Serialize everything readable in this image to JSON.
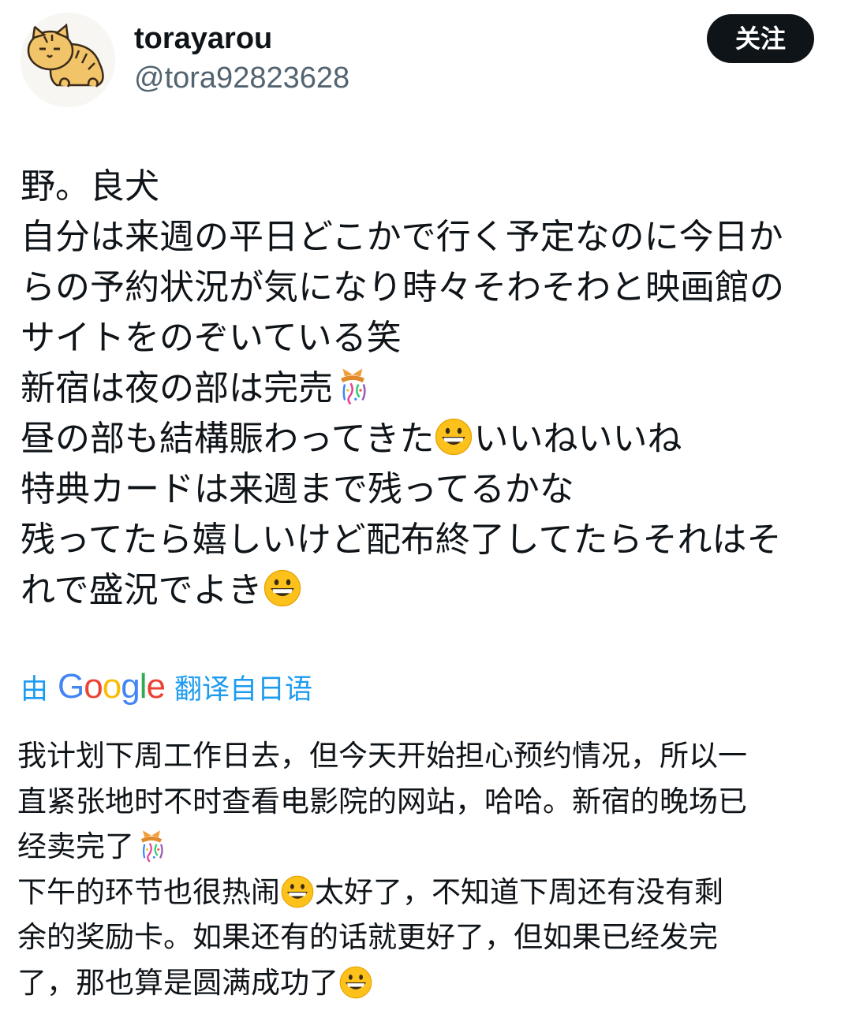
{
  "user": {
    "display_name": "torayarou",
    "handle": "@tora92823628",
    "avatar_icon": "tiger-cat-avatar"
  },
  "follow_button": {
    "label": "关注"
  },
  "tweet": {
    "lines": [
      {
        "text": "野。良犬"
      },
      {
        "text": "自分は来週の平日どこかで行く予定なのに今日か"
      },
      {
        "text": "らの予約状況が気になり時々そわそわと映画館の"
      },
      {
        "text": "サイトをのぞいている笑"
      },
      {
        "text": "新宿は夜の部は完売",
        "emoji": "confetti-ball-icon"
      },
      {
        "text": "昼の部も結構賑わってきた",
        "emoji": "grinning-face-icon",
        "after": "いいねいいね"
      },
      {
        "text": "特典カードは来週まで残ってるかな"
      },
      {
        "text": "残ってたら嬉しいけど配布終了してたらそれはそ"
      },
      {
        "text": "れで盛況でよき",
        "emoji": "grinning-face-icon"
      }
    ]
  },
  "translation": {
    "prefix": "由",
    "google": "Google",
    "suffix": "翻译自日语",
    "lines": [
      {
        "text": "我计划下周工作日去，但今天开始担心预约情况，所以一"
      },
      {
        "text": "直紧张地时不时查看电影院的网站，哈哈。新宿的晚场已"
      },
      {
        "text": "经卖完了",
        "emoji": "confetti-ball-icon"
      },
      {
        "text": "下午的环节也很热闹",
        "emoji": "grinning-face-icon",
        "after": "太好了，不知道下周还有没有剩"
      },
      {
        "text": "余的奖励卡。如果还有的话就更好了，但如果已经发完"
      },
      {
        "text": "了，那也算是圆满成功了",
        "emoji": "grinning-face-icon"
      }
    ]
  },
  "colors": {
    "text_primary": "#0f1419",
    "text_secondary": "#536471",
    "link_blue": "#1d9bf0",
    "button_bg": "#0f1419",
    "google_blue": "#4285f4",
    "google_red": "#ea4335",
    "google_yellow": "#fbbc05",
    "google_green": "#34a853"
  }
}
